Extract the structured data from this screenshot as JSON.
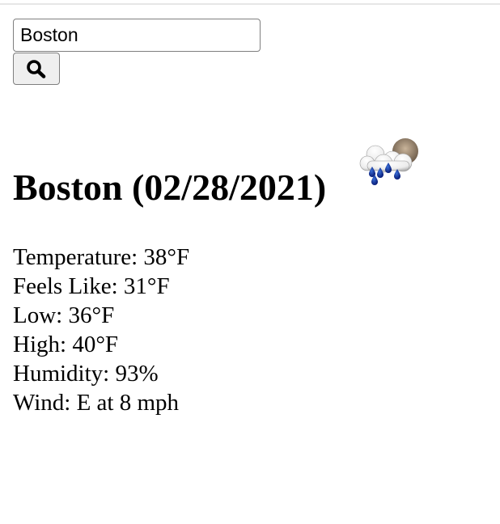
{
  "search": {
    "value": "Boston"
  },
  "weather": {
    "city": "Boston",
    "date": "(02/28/2021)",
    "icon": "rain-cloud-with-moon-icon",
    "details": [
      {
        "label": "Temperature:",
        "value": "38°F"
      },
      {
        "label": "Feels Like:",
        "value": "31°F"
      },
      {
        "label": "Low:",
        "value": "36°F"
      },
      {
        "label": "High:",
        "value": "40°F"
      },
      {
        "label": "Humidity:",
        "value": "93%"
      },
      {
        "label": "Wind:",
        "value": "E at 8 mph"
      }
    ]
  }
}
